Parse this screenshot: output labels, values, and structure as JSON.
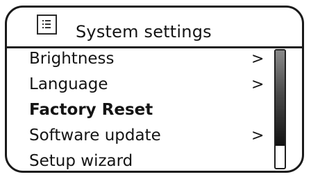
{
  "header": {
    "title": "System settings",
    "icon": "list-icon"
  },
  "menu": {
    "items": [
      {
        "label": "Brightness",
        "arrow": ">"
      },
      {
        "label": "Language",
        "arrow": ">"
      },
      {
        "label": "Factory Reset",
        "arrow": "",
        "selected": true
      },
      {
        "label": "Software update",
        "arrow": ">"
      },
      {
        "label": "Setup wizard",
        "arrow": ""
      }
    ]
  },
  "scrollbar": {
    "thumb_start": 0,
    "thumb_fraction": 0.81
  }
}
